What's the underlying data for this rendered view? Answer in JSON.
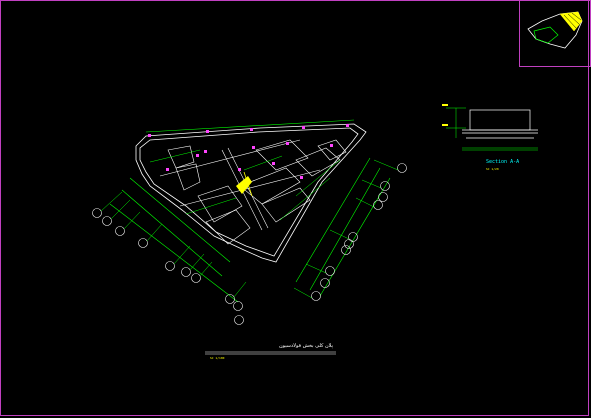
{
  "drawing": {
    "title": "پلان کلی بخش فولادسیون",
    "scale": "SC 1/100",
    "section_title": "Section A-A",
    "section_scale": "SC 1/20"
  },
  "colors": {
    "background": "#000000",
    "frame": "#c040c0",
    "wall": "#ffffff",
    "dimension": "#00ff00",
    "grid_bubble": "#ffffff",
    "highlight": "#ffff00",
    "marker": "#ff44ff",
    "text_cyan": "#00ffff"
  }
}
